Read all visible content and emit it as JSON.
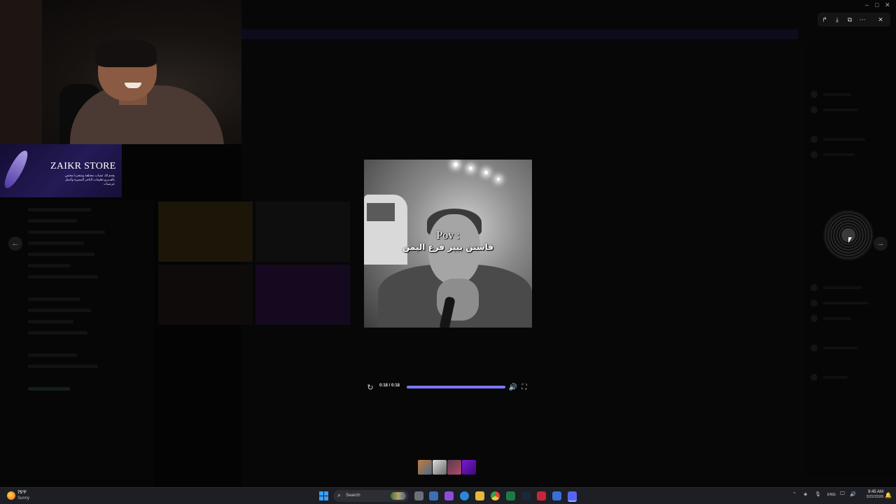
{
  "webcam": {
    "label": ""
  },
  "store": {
    "name": "ZAIKR STORE",
    "tagline": "يقدم لك عصاب مختلفة ومتجرنا مختص بالفـيـرو تعليمات التاجر المميزة وأجمل عرضيات"
  },
  "viewer": {
    "top_actions": [
      "share-icon",
      "download-icon",
      "open-external-icon",
      "more-icon",
      "close-icon"
    ],
    "video": {
      "overlay_title": "Pov :",
      "overlay_caption": "قاستن بيير فرع اليمن"
    },
    "player": {
      "time": "0:18 / 0:18",
      "progress": 1.0,
      "accent": "#7b77f2"
    },
    "thumbnail_count": 4
  },
  "taskbar": {
    "weather": {
      "temp": "75°F",
      "condition": "Sunny"
    },
    "search_placeholder": "Search",
    "language": "ENG",
    "time": "9:45 AM",
    "date": "3/22/2026"
  }
}
